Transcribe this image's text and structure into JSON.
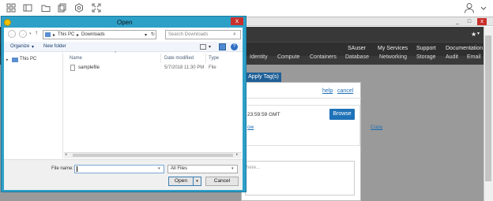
{
  "toolbar": {
    "icons": [
      "grid-icon",
      "tablet-icon",
      "folder-icon",
      "copy-icon",
      "settings-icon",
      "fullscreen-icon",
      "user-icon",
      "chevron-down-icon"
    ]
  },
  "remote_window": {
    "controls": {
      "minimize": "_",
      "maximize": "□",
      "close": "x"
    }
  },
  "console": {
    "user_menu": "SAuser",
    "my_services": "My Services",
    "support": "Support",
    "documentation": "Documentation",
    "services": [
      "Identity",
      "Compute",
      "Containers",
      "Database",
      "Networking",
      "Storage",
      "Audit",
      "Email"
    ],
    "apply_tags": "Apply Tag(s)",
    "help": "help",
    "cancel": "cancel",
    "browse": "Browse",
    "date_text": "23:59:59 GMT",
    "show": "ow",
    "copy": "Copy",
    "notes_placeholder": "here..."
  },
  "open_dialog": {
    "title": "Open",
    "close_label": "x",
    "breadcrumb": [
      "This PC",
      "Downloads"
    ],
    "search_placeholder": "Search Downloads",
    "organize": "Organize",
    "new_folder": "New folder",
    "nav_pane": [
      "This PC"
    ],
    "columns": {
      "name": "Name",
      "date_modified": "Date modified",
      "type": "Type"
    },
    "files": [
      {
        "name": "samplefile",
        "date": "5/7/2018 11:30 PM",
        "type": "File"
      }
    ],
    "file_name_label": "File name:",
    "file_name_value": "",
    "file_type": "All Files",
    "open_label": "Open",
    "cancel_label": "Cancel"
  },
  "colors": {
    "dialog_frame": "#2da0c8",
    "browse_button": "#1f72b8",
    "apply_tags_button": "#1f5f96",
    "console_nav": "#2f2f2f"
  }
}
